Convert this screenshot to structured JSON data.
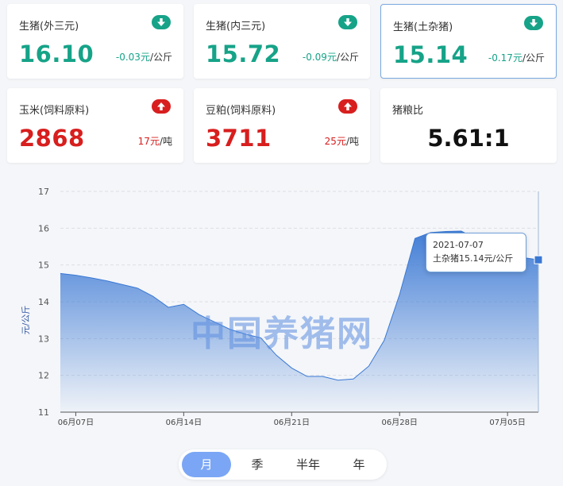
{
  "cards": [
    {
      "label": "生猪(外三元)",
      "value": "16.10",
      "change": "-0.03元",
      "unit": "/公斤",
      "trend": "down",
      "arrow": "down-arrow-icon"
    },
    {
      "label": "生猪(内三元)",
      "value": "15.72",
      "change": "-0.09元",
      "unit": "/公斤",
      "trend": "down",
      "arrow": "down-arrow-icon"
    },
    {
      "label": "生猪(土杂猪)",
      "value": "15.14",
      "change": "-0.17元",
      "unit": "/公斤",
      "trend": "down",
      "arrow": "down-arrow-icon"
    },
    {
      "label": "玉米(饲料原料)",
      "value": "2868",
      "change": "17元",
      "unit": "/吨",
      "trend": "up",
      "arrow": "up-arrow-icon"
    },
    {
      "label": "豆粕(饲料原料)",
      "value": "3711",
      "change": "25元",
      "unit": "/吨",
      "trend": "up",
      "arrow": "up-arrow-icon"
    },
    {
      "label": "猪粮比",
      "value": "5.61:1"
    }
  ],
  "colors": {
    "down": "#16a388",
    "up": "#d81e1e",
    "series": "#3a78d4"
  },
  "watermark": "中国养猪网",
  "tooltip": {
    "date": "2021-07-07",
    "text": "土杂猪15.14元/公斤"
  },
  "tabs": [
    "月",
    "季",
    "半年",
    "年"
  ],
  "active_tab": "月",
  "chart_data": {
    "type": "area",
    "ylabel": "元/公斤",
    "ylim": [
      11,
      17
    ],
    "yticks": [
      11,
      12,
      13,
      14,
      15,
      16,
      17
    ],
    "xticks": [
      "06月07日",
      "06月14日",
      "06月21日",
      "06月28日",
      "07月05日"
    ],
    "x": [
      "06-06",
      "06-07",
      "06-08",
      "06-09",
      "06-10",
      "06-11",
      "06-12",
      "06-13",
      "06-14",
      "06-15",
      "06-16",
      "06-17",
      "06-18",
      "06-19",
      "06-20",
      "06-21",
      "06-22",
      "06-23",
      "06-24",
      "06-25",
      "06-26",
      "06-27",
      "06-28",
      "06-29",
      "06-30",
      "07-01",
      "07-02",
      "07-03",
      "07-04",
      "07-05",
      "07-06",
      "07-07"
    ],
    "series": [
      {
        "name": "土杂猪",
        "values": [
          14.77,
          14.72,
          14.65,
          14.57,
          14.47,
          14.37,
          14.15,
          13.85,
          13.93,
          13.65,
          13.45,
          13.25,
          13.12,
          13.02,
          12.55,
          12.2,
          11.97,
          11.97,
          11.87,
          11.9,
          12.25,
          12.95,
          14.2,
          15.72,
          15.88,
          15.91,
          15.92,
          15.7,
          15.46,
          15.28,
          15.2,
          15.14
        ]
      }
    ],
    "grid": true
  }
}
